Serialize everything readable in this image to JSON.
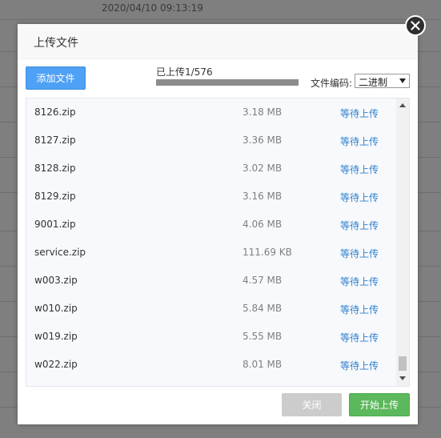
{
  "background": {
    "timestamp": "2020/04/10 09:13:19"
  },
  "dialog": {
    "title": "上传文件",
    "add_button_label": "添加文件",
    "progress": {
      "text": "已上传1/576",
      "uploaded": 1,
      "total": 576,
      "bar_fraction": 1.0
    },
    "encoding": {
      "label": "文件编码:",
      "selected": "二进制"
    },
    "files": [
      {
        "name": "8126.zip",
        "size": "3.18 MB",
        "status": "等待上传"
      },
      {
        "name": "8127.zip",
        "size": "3.36 MB",
        "status": "等待上传"
      },
      {
        "name": "8128.zip",
        "size": "3.02 MB",
        "status": "等待上传"
      },
      {
        "name": "8129.zip",
        "size": "3.16 MB",
        "status": "等待上传"
      },
      {
        "name": "9001.zip",
        "size": "4.06 MB",
        "status": "等待上传"
      },
      {
        "name": "service.zip",
        "size": "111.69 KB",
        "status": "等待上传"
      },
      {
        "name": "w003.zip",
        "size": "4.57 MB",
        "status": "等待上传"
      },
      {
        "name": "w010.zip",
        "size": "5.84 MB",
        "status": "等待上传"
      },
      {
        "name": "w019.zip",
        "size": "5.55 MB",
        "status": "等待上传"
      },
      {
        "name": "w022.zip",
        "size": "8.01 MB",
        "status": "等待上传"
      }
    ],
    "close_button_label": "关闭",
    "start_button_label": "开始上传"
  },
  "colors": {
    "accent_blue": "#4ea1f5",
    "status_blue": "#2f80d0",
    "start_green": "#5cb85c",
    "disabled_gray": "#cccccc"
  },
  "icons": {
    "close": "close-icon",
    "dropdown": "chevron-down-icon"
  }
}
